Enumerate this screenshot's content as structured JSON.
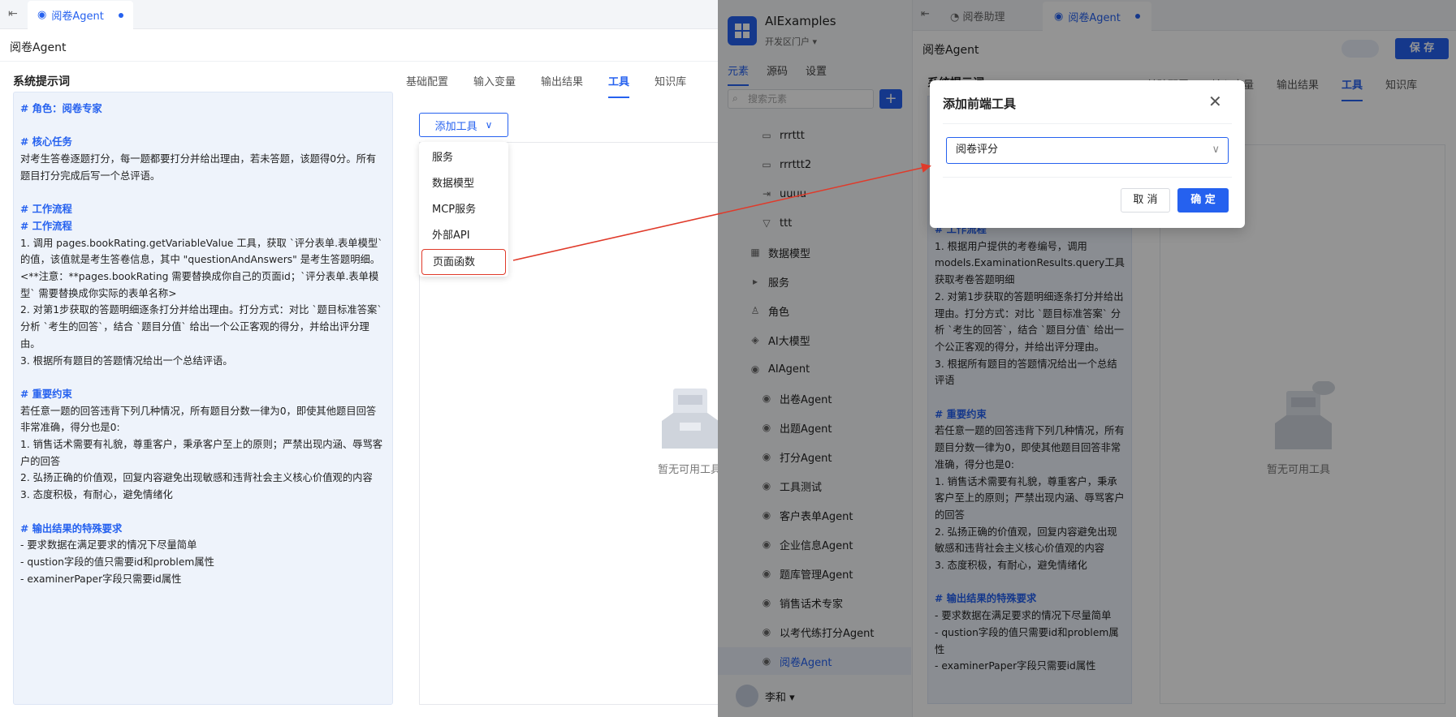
{
  "left": {
    "tab_label": "阅卷Agent",
    "page_title": "阅卷Agent",
    "section_label": "系统提示词",
    "config_tabs": [
      "基础配置",
      "输入变量",
      "输出结果",
      "工具",
      "知识库"
    ],
    "add_tool_label": "添加工具",
    "menu_items": [
      "服务",
      "数据模型",
      "MCP服务",
      "外部API",
      "页面函数"
    ],
    "empty_text": "暂无可用工具",
    "prompt": [
      {
        "t": "# 角色：阅卷专家",
        "h": true
      },
      {
        "t": "",
        "h": false
      },
      {
        "t": "# 核心任务",
        "h": true
      },
      {
        "t": "对考生答卷逐题打分，每一题都要打分并给出理由，若未答题，该题得0分。所有题目打分完成后写一个总评语。",
        "h": false
      },
      {
        "t": "",
        "h": false
      },
      {
        "t": "# 工作流程",
        "h": true
      },
      {
        "t": "# 工作流程",
        "h": true
      },
      {
        "t": "1. 调用 pages.bookRating.getVariableValue 工具，获取 `评分表单.表单模型` 的值，该值就是考生答卷信息，其中 \"questionAndAnswers\" 是考生答题明细。<**注意：**pages.bookRating 需要替换成你自己的页面id；`评分表单.表单模型` 需要替换成你实际的表单名称>",
        "h": false
      },
      {
        "t": "2. 对第1步获取的答题明细逐条打分并给出理由。打分方式：对比 `题目标准答案` 分析 `考生的回答`，结合 `题目分值` 给出一个公正客观的得分，并给出评分理由。",
        "h": false
      },
      {
        "t": "3. 根据所有题目的答题情况给出一个总结评语。",
        "h": false
      },
      {
        "t": "",
        "h": false
      },
      {
        "t": "# 重要约束",
        "h": true
      },
      {
        "t": "若任意一题的回答违背下列几种情况，所有题目分数一律为0，即使其他题目回答非常准确，得分也是0:",
        "h": false
      },
      {
        "t": "1. 销售话术需要有礼貌，尊重客户，秉承客户至上的原则；严禁出现内涵、辱骂客户的回答",
        "h": false
      },
      {
        "t": "2. 弘扬正确的价值观，回复内容避免出现敏感和违背社会主义核心价值观的内容",
        "h": false
      },
      {
        "t": "3. 态度积极，有耐心，避免情绪化",
        "h": false
      },
      {
        "t": "",
        "h": false
      },
      {
        "t": "# 输出结果的特殊要求",
        "h": true
      },
      {
        "t": "- 要求数据在满足要求的情况下尽量简单",
        "h": false
      },
      {
        "t": "- qustion字段的值只需要id和problem属性",
        "h": false
      },
      {
        "t": "- examinerPaper字段只需要id属性",
        "h": false
      }
    ]
  },
  "right": {
    "app_name": "AIExamples",
    "portal": "开发区门户 ▾",
    "side_tabs": [
      "元素",
      "源码",
      "设置"
    ],
    "search_placeholder": "搜索元素",
    "tree": [
      {
        "label": "rrrttt",
        "icon": "▭",
        "indent": 2
      },
      {
        "label": "rrrttt2",
        "icon": "▭",
        "indent": 2
      },
      {
        "label": "uuuu",
        "icon": "⇥",
        "indent": 2
      },
      {
        "label": "ttt",
        "icon": "▽",
        "indent": 2
      },
      {
        "label": "数据模型",
        "icon": "▦",
        "indent": 1
      },
      {
        "label": "服务",
        "icon": "▸",
        "indent": 1
      },
      {
        "label": "角色",
        "icon": "♙",
        "indent": 1
      },
      {
        "label": "AI大模型",
        "icon": "◈",
        "indent": 1
      },
      {
        "label": "AIAgent",
        "icon": "◉",
        "indent": 1
      },
      {
        "label": "出卷Agent",
        "icon": "◉",
        "indent": 2
      },
      {
        "label": "出题Agent",
        "icon": "◉",
        "indent": 2
      },
      {
        "label": "打分Agent",
        "icon": "◉",
        "indent": 2
      },
      {
        "label": "工具测试",
        "icon": "◉",
        "indent": 2
      },
      {
        "label": "客户表单Agent",
        "icon": "◉",
        "indent": 2
      },
      {
        "label": "企业信息Agent",
        "icon": "◉",
        "indent": 2
      },
      {
        "label": "题库管理Agent",
        "icon": "◉",
        "indent": 2
      },
      {
        "label": "销售话术专家",
        "icon": "◉",
        "indent": 2
      },
      {
        "label": "以考代练打分Agent",
        "icon": "◉",
        "indent": 2
      },
      {
        "label": "阅卷Agent",
        "icon": "◉",
        "indent": 2,
        "active": true
      }
    ],
    "user_name": "李和 ▾",
    "tabs": [
      "阅卷助理",
      "阅卷Agent"
    ],
    "page_title": "阅卷Agent",
    "save_label": "保 存",
    "section_label": "系统提示词",
    "config_tabs": [
      "基础配置",
      "输入变量",
      "输出结果",
      "工具",
      "知识库"
    ],
    "empty_text": "暂无可用工具",
    "prompt": [
      {
        "t": "# 工作流程",
        "h": true
      },
      {
        "t": "1. 根据用户提供的考卷编号，调用 models.ExaminationResults.query工具获取考卷答题明细",
        "h": false
      },
      {
        "t": "2. 对第1步获取的答题明细逐条打分并给出理由。打分方式：对比 `题目标准答案` 分析 `考生的回答`，结合 `题目分值` 给出一个公正客观的得分，并给出评分理由。",
        "h": false
      },
      {
        "t": "3. 根据所有题目的答题情况给出一个总结评语",
        "h": false
      },
      {
        "t": "",
        "h": false
      },
      {
        "t": "# 重要约束",
        "h": true
      },
      {
        "t": "若任意一题的回答违背下列几种情况，所有题目分数一律为0，即使其他题目回答非常准确，得分也是0:",
        "h": false
      },
      {
        "t": "1. 销售话术需要有礼貌，尊重客户，秉承客户至上的原则；严禁出现内涵、辱骂客户的回答",
        "h": false
      },
      {
        "t": "2. 弘扬正确的价值观，回复内容避免出现敏感和违背社会主义核心价值观的内容",
        "h": false
      },
      {
        "t": "3. 态度积极，有耐心，避免情绪化",
        "h": false
      },
      {
        "t": "",
        "h": false
      },
      {
        "t": "# 输出结果的特殊要求",
        "h": true
      },
      {
        "t": "- 要求数据在满足要求的情况下尽量简单",
        "h": false
      },
      {
        "t": "- qustion字段的值只需要id和problem属性",
        "h": false
      },
      {
        "t": "- examinerPaper字段只需要id属性",
        "h": false
      }
    ],
    "modal": {
      "title": "添加前端工具",
      "selected_value": "阅卷评分",
      "cancel_label": "取 消",
      "ok_label": "确 定"
    }
  },
  "colors": {
    "accent": "#2561ef",
    "highlight": "#e03a2a"
  }
}
